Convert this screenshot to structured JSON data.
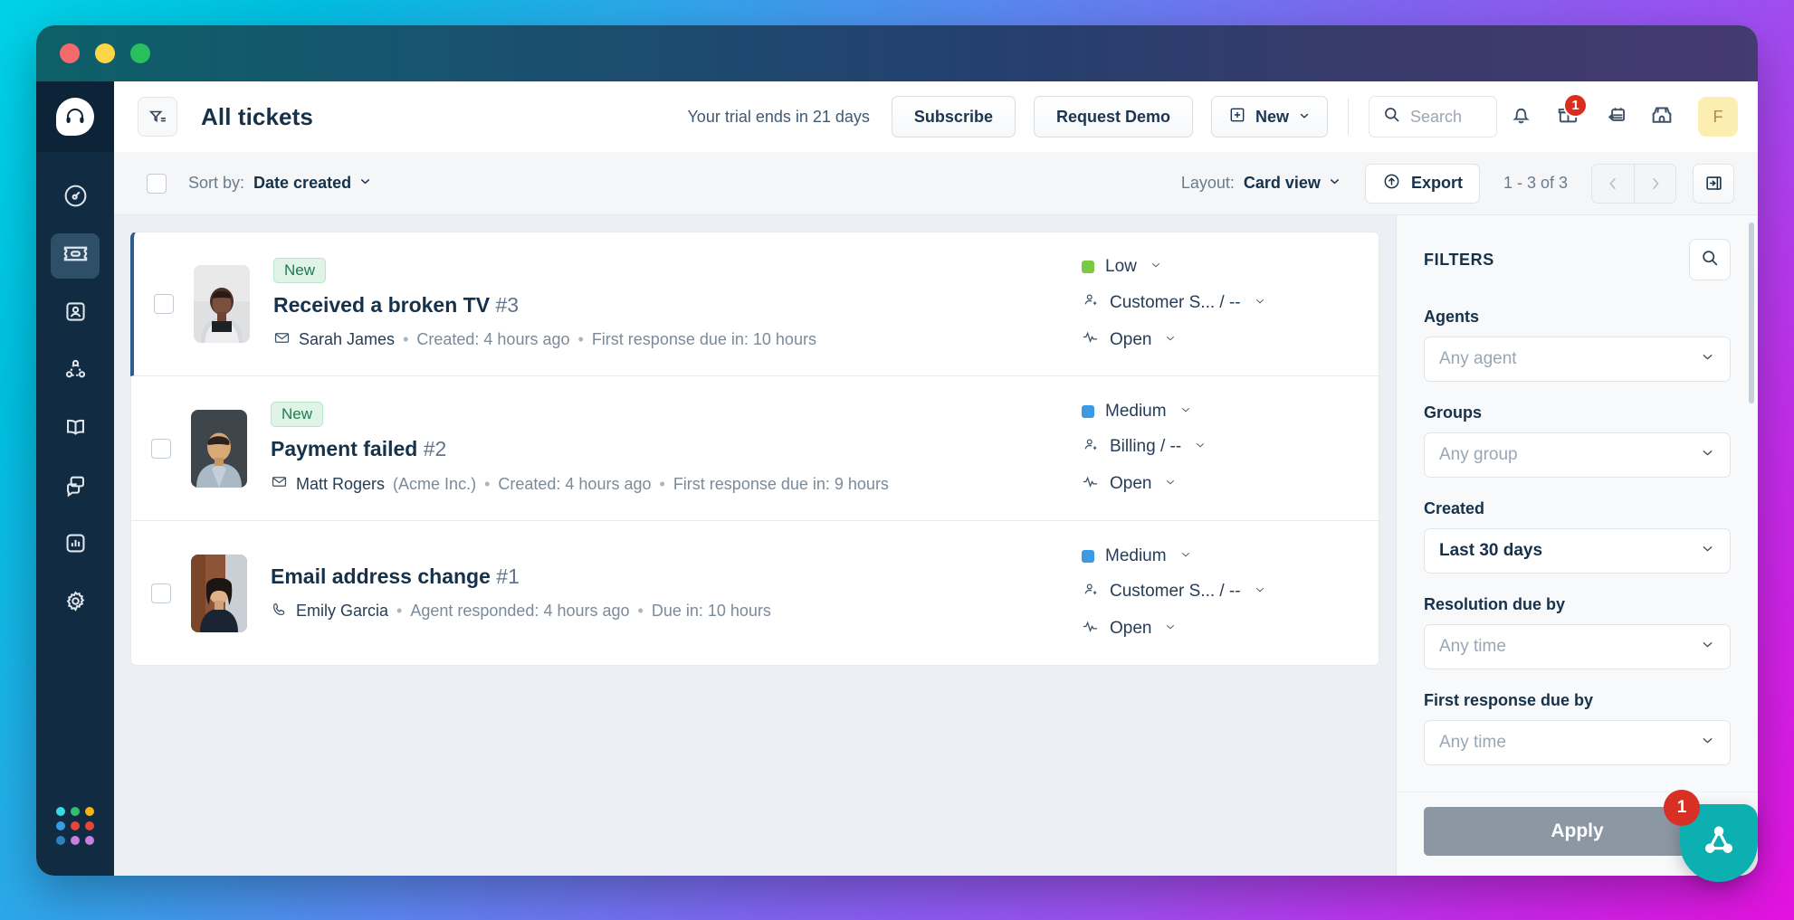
{
  "window": {
    "traffic_lights": [
      "close",
      "minimize",
      "maximize"
    ]
  },
  "sidebar": {
    "logo_icon": "headset-logo-icon",
    "items": [
      {
        "name": "dashboard",
        "icon": "gauge-icon",
        "active": false
      },
      {
        "name": "tickets",
        "icon": "ticket-icon",
        "active": true
      },
      {
        "name": "contacts",
        "icon": "contact-card-icon",
        "active": false
      },
      {
        "name": "social",
        "icon": "network-icon",
        "active": false
      },
      {
        "name": "knowledge-base",
        "icon": "book-icon",
        "active": false
      },
      {
        "name": "forums",
        "icon": "chat-windows-icon",
        "active": false
      },
      {
        "name": "analytics",
        "icon": "bar-chart-icon",
        "active": false
      },
      {
        "name": "admin",
        "icon": "gear-icon",
        "active": false
      }
    ],
    "app_switcher": {
      "icon": "apps-grid-icon",
      "dot_colors": [
        "#38d9e8",
        "#2fbf6e",
        "#f7b314",
        "#3b9ae1",
        "#e8453c",
        "#e8453c",
        "#2f7fc1",
        "#c77fe0",
        "#c77fe0"
      ]
    }
  },
  "topbar": {
    "filter_toggle_icon": "filter-list-icon",
    "title": "All tickets",
    "trial_text": "Your trial ends in 21 days",
    "subscribe_label": "Subscribe",
    "request_demo_label": "Request Demo",
    "new_label": "New",
    "new_icon": "plus-square-icon",
    "search_placeholder": "Search",
    "search_icon": "search-icon",
    "bell_icon": "bell-icon",
    "gift_icon": "gift-icon",
    "gift_badge": "1",
    "release_notes_icon": "calendar-back-icon",
    "marketplace_icon": "storefront-icon",
    "avatar_initial": "F"
  },
  "toolbar": {
    "select_all": false,
    "sort_label": "Sort by:",
    "sort_value": "Date created",
    "layout_label": "Layout:",
    "layout_value": "Card view",
    "export_label": "Export",
    "export_icon": "upload-circle-icon",
    "count_text": "1 - 3 of 3",
    "prev_icon": "chevron-left-icon",
    "next_icon": "chevron-right-icon",
    "panel_toggle_icon": "collapse-panel-icon"
  },
  "tickets": [
    {
      "selected": false,
      "tag": "New",
      "title": "Received a broken TV",
      "number": "#3",
      "channel_icon": "envelope-icon",
      "requester": "Sarah James",
      "org": "",
      "meta1": "Created: 4 hours ago",
      "meta2": "First response due in: 10 hours",
      "priority": "Low",
      "priority_color": "#7ac943",
      "group": "Customer S... / --",
      "status": "Open",
      "avatar_name": "avatar-sarah-james"
    },
    {
      "selected": false,
      "tag": "New",
      "title": "Payment failed",
      "number": "#2",
      "channel_icon": "envelope-icon",
      "requester": "Matt Rogers",
      "org": "(Acme Inc.)",
      "meta1": "Created: 4 hours ago",
      "meta2": "First response due in: 9 hours",
      "priority": "Medium",
      "priority_color": "#3b9ae1",
      "group": "Billing / --",
      "status": "Open",
      "avatar_name": "avatar-matt-rogers"
    },
    {
      "selected": false,
      "tag": "",
      "title": "Email address change",
      "number": "#1",
      "channel_icon": "phone-icon",
      "requester": "Emily Garcia",
      "org": "",
      "meta1": "Agent responded: 4 hours ago",
      "meta2": "Due in: 10 hours",
      "priority": "Medium",
      "priority_color": "#3b9ae1",
      "group": "Customer S... / --",
      "status": "Open",
      "avatar_name": "avatar-emily-garcia"
    }
  ],
  "filters": {
    "title": "FILTERS",
    "search_icon": "search-icon",
    "fields": [
      {
        "label": "Agents",
        "value": "Any agent",
        "filled": false
      },
      {
        "label": "Groups",
        "value": "Any group",
        "filled": false
      },
      {
        "label": "Created",
        "value": "Last 30 days",
        "filled": true
      },
      {
        "label": "Resolution due by",
        "value": "Any time",
        "filled": false
      },
      {
        "label": "First response due by",
        "value": "Any time",
        "filled": false
      }
    ],
    "apply_label": "Apply"
  },
  "fab": {
    "icon": "triangle-nodes-icon",
    "badge": "1",
    "color": "#0cb0b0"
  }
}
